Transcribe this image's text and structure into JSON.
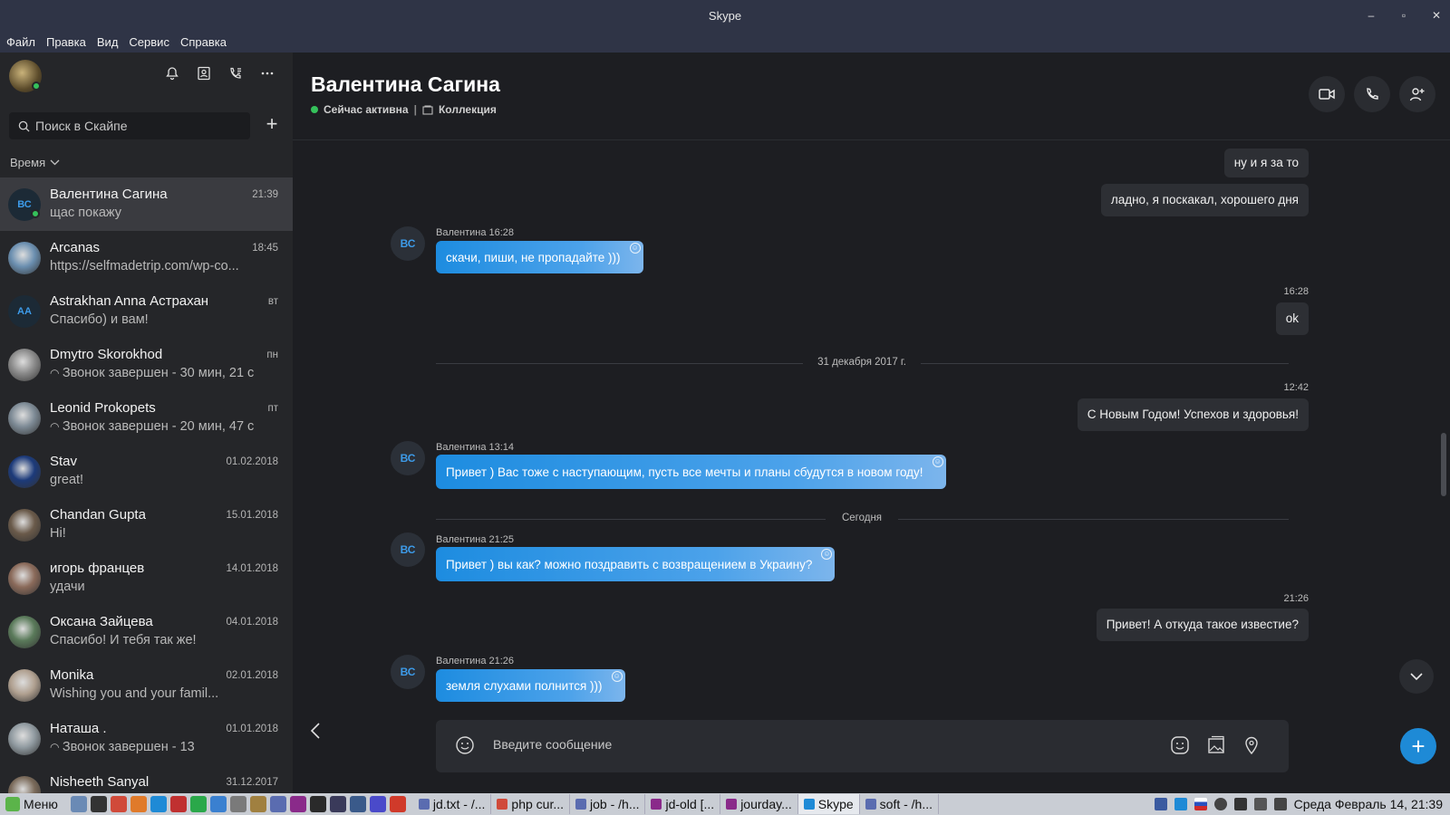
{
  "window": {
    "title": "Skype"
  },
  "menu": [
    "Файл",
    "Правка",
    "Вид",
    "Сервис",
    "Справка"
  ],
  "sidebar": {
    "search_placeholder": "Поиск в Скайпе",
    "sort_label": "Время",
    "contacts": [
      {
        "name": "Валентина Сагина",
        "time": "21:39",
        "snippet": "щас покажу",
        "initials": "ВС",
        "online": true,
        "active": true
      },
      {
        "name": "Arcanas",
        "time": "18:45",
        "snippet": "https://selfmadetrip.com/wp-co...",
        "avatar_color": "#6b8fb0"
      },
      {
        "name": "Astrakhan  Anna Астрахан",
        "time": "вт",
        "snippet": "Спасибо) и вам!",
        "initials": "АА"
      },
      {
        "name": "Dmytro Skorokhod",
        "time": "пн",
        "snippet": "Звонок завершен - 30 мин, 21 с",
        "call": true,
        "avatar_color": "#8a8a8a"
      },
      {
        "name": "Leonid Prokopets",
        "time": "пт",
        "snippet": "Звонок завершен - 20 мин, 47 с",
        "call": true,
        "avatar_color": "#7d8a95"
      },
      {
        "name": "Stav",
        "time": "01.02.2018",
        "snippet": "great!",
        "avatar_color": "#1c3a7a"
      },
      {
        "name": "Chandan Gupta",
        "time": "15.01.2018",
        "snippet": "Hi!",
        "avatar_color": "#6a5a4a"
      },
      {
        "name": "игорь францев",
        "time": "14.01.2018",
        "snippet": "удачи",
        "avatar_color": "#8a6a5a"
      },
      {
        "name": "Оксана Зайцева",
        "time": "04.01.2018",
        "snippet": "Спасибо! И тебя так же!",
        "avatar_color": "#5a7a5a"
      },
      {
        "name": "Monika",
        "time": "02.01.2018",
        "snippet": "Wishing you and your famil...",
        "avatar_color": "#b0a090"
      },
      {
        "name": "Наташа .",
        "time": "01.01.2018",
        "snippet": "Звонок завершен - 13",
        "call": true,
        "avatar_color": "#909aa0"
      },
      {
        "name": "Nisheeth  Sanyal",
        "time": "31.12.2017",
        "snippet": "",
        "avatar_color": "#7a6a5a"
      }
    ]
  },
  "chat": {
    "title": "Валентина Сагина",
    "status": "Сейчас активна",
    "collection": "Коллекция",
    "messages": {
      "out1": "ну и я за то",
      "out2": "ладно, я поскакал, хорошего дня",
      "in1_meta": "Валентина 16:28",
      "in1": "скачи, пиши, не пропадайте )))",
      "out3_time": "16:28",
      "out3": "ok",
      "sep1": "31 декабря 2017 г.",
      "out4_time": "12:42",
      "out4": "С Новым Годом! Успехов и здоровья!",
      "in2_meta": "Валентина 13:14",
      "in2": "Привет ) Вас тоже с наступающим, пусть все мечты и планы сбудутся в новом году!",
      "sep2": "Сегодня",
      "in3_meta": "Валентина 21:25",
      "in3": "Привет ) вы как? можно поздравить с возвращением в Украину?",
      "out5_time": "21:26",
      "out5": "Привет! А откуда такое известие?",
      "in4_meta": "Валентина 21:26",
      "in4": "земля слухами полнится )))"
    },
    "initials": "ВС",
    "compose_placeholder": "Введите сообщение"
  },
  "taskbar": {
    "menu_label": "Меню",
    "tasks": [
      "jd.txt - /...",
      "php cur...",
      "job - /h...",
      "jd-old [...",
      "jourday...",
      "Skype",
      "soft - /h..."
    ],
    "clock": "Среда Февраль 14, 21:39"
  },
  "colors": {
    "accent": "#1e8ad6",
    "online": "#35c15b",
    "sidebar": "#252629",
    "main": "#1d1e22"
  }
}
